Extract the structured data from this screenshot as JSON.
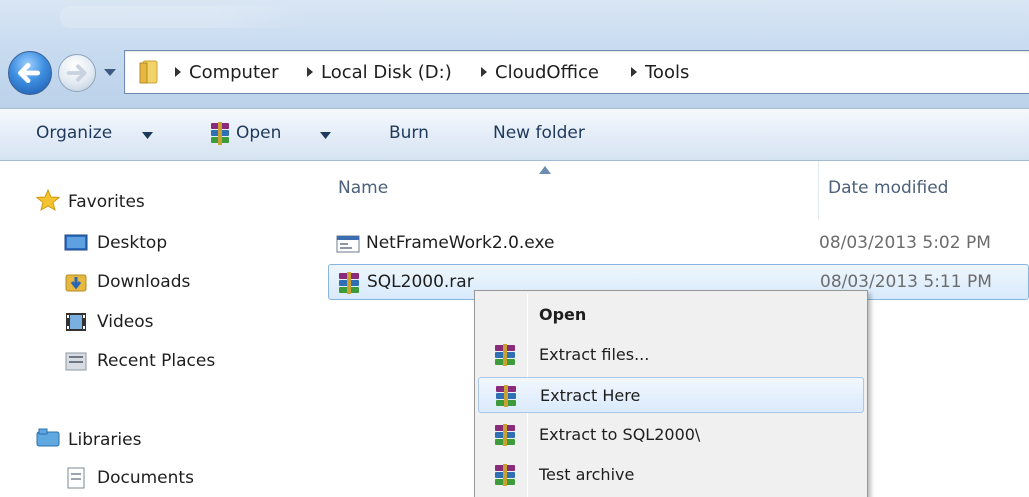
{
  "address_bar": {
    "breadcrumbs": [
      "Computer",
      "Local Disk (D:)",
      "CloudOffice",
      "Tools"
    ]
  },
  "command_bar": {
    "organize": "Organize",
    "open": "Open",
    "burn": "Burn",
    "new_folder": "New folder"
  },
  "navigation": {
    "favorites": "Favorites",
    "desktop": "Desktop",
    "downloads": "Downloads",
    "videos": "Videos",
    "recent_places": "Recent Places",
    "libraries": "Libraries",
    "documents": "Documents"
  },
  "file_list": {
    "columns": {
      "name": "Name",
      "date_modified": "Date modified"
    },
    "files": [
      {
        "name": "NetFrameWork2.0.exe",
        "date": "08/03/2013 5:02 PM",
        "icon": "exe-icon"
      },
      {
        "name": "SQL2000.rar",
        "date": "08/03/2013 5:11 PM",
        "icon": "winrar-icon",
        "selected": true
      }
    ]
  },
  "context_menu": {
    "items": [
      "Open",
      "Extract files...",
      "Extract Here",
      "Extract to SQL2000\\",
      "Test archive"
    ],
    "hovered": "Extract Here"
  },
  "colors": {
    "titlebar": "#c9dcf0",
    "command_bar": "#e3ecf7",
    "selection": "#d8eafb",
    "menu_background": "#f0f0f0"
  }
}
